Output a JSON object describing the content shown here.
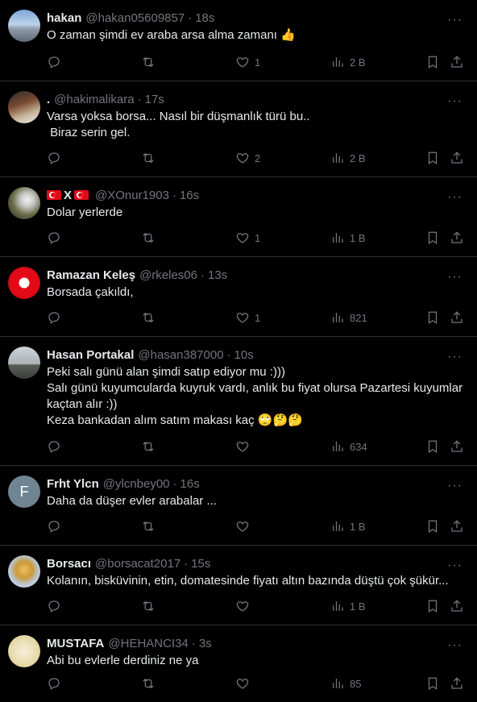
{
  "tweets": [
    {
      "name": "hakan",
      "handle": "@hakan05609857",
      "time": "18s",
      "text": "O zaman şimdi ev araba arsa alma zamanı 👍",
      "likes": "1",
      "views": "2 B"
    },
    {
      "name": ".",
      "handle": "@hakimalikara",
      "time": "17s",
      "text": "Varsa yoksa borsa... Nasıl bir düşmanlık türü bu..\n Biraz serin gel.",
      "likes": "2",
      "views": "2 B"
    },
    {
      "name": "X",
      "handle": "@XOnur1903",
      "time": "16s",
      "text": "Dolar yerlerde",
      "likes": "1",
      "views": "1 B"
    },
    {
      "name": "Ramazan Keleş",
      "handle": "@rkeles06",
      "time": "13s",
      "text": "Borsada çakıldı,",
      "likes": "1",
      "views": "821"
    },
    {
      "name": "Hasan Portakal",
      "handle": "@hasan387000",
      "time": "10s",
      "text": "Peki salı günü alan şimdi satıp ediyor mu :)))\nSalı günü kuyumcularda kuyruk vardı, anlık bu fiyat olursa Pazartesi kuyumlar kaçtan alır :))\nKeza bankadan alım satım makası kaç 🙄🤔🤔",
      "likes": "",
      "views": "634"
    },
    {
      "name": "Frht Ylcn",
      "handle": "@ylcnbey00",
      "time": "16s",
      "text": "Daha da düşer evler arabalar ...",
      "likes": "",
      "views": "1 B"
    },
    {
      "name": "Borsacı",
      "handle": "@borsacat2017",
      "time": "15s",
      "text": "Kolanın, bisküvinin, etin, domatesinde fiyatı altın bazında düştü çok şükür...",
      "likes": "",
      "views": "1 B"
    },
    {
      "name": "MUSTAFA",
      "handle": "@HEHANCI34",
      "time": "3s",
      "text": "Abi bu evlerle derdiniz ne ya",
      "likes": "",
      "views": "85"
    }
  ],
  "avatar_letter_frht": "F",
  "more_glyph": "···",
  "dot": "·",
  "icons": [
    "reply-icon",
    "retweet-icon",
    "heart-icon",
    "views-icon",
    "bookmark-icon",
    "share-icon",
    "more-icon"
  ],
  "colors": {
    "background": "#000000",
    "text": "#e7e9ea",
    "secondary": "#71767b",
    "divider": "#2f3336"
  }
}
